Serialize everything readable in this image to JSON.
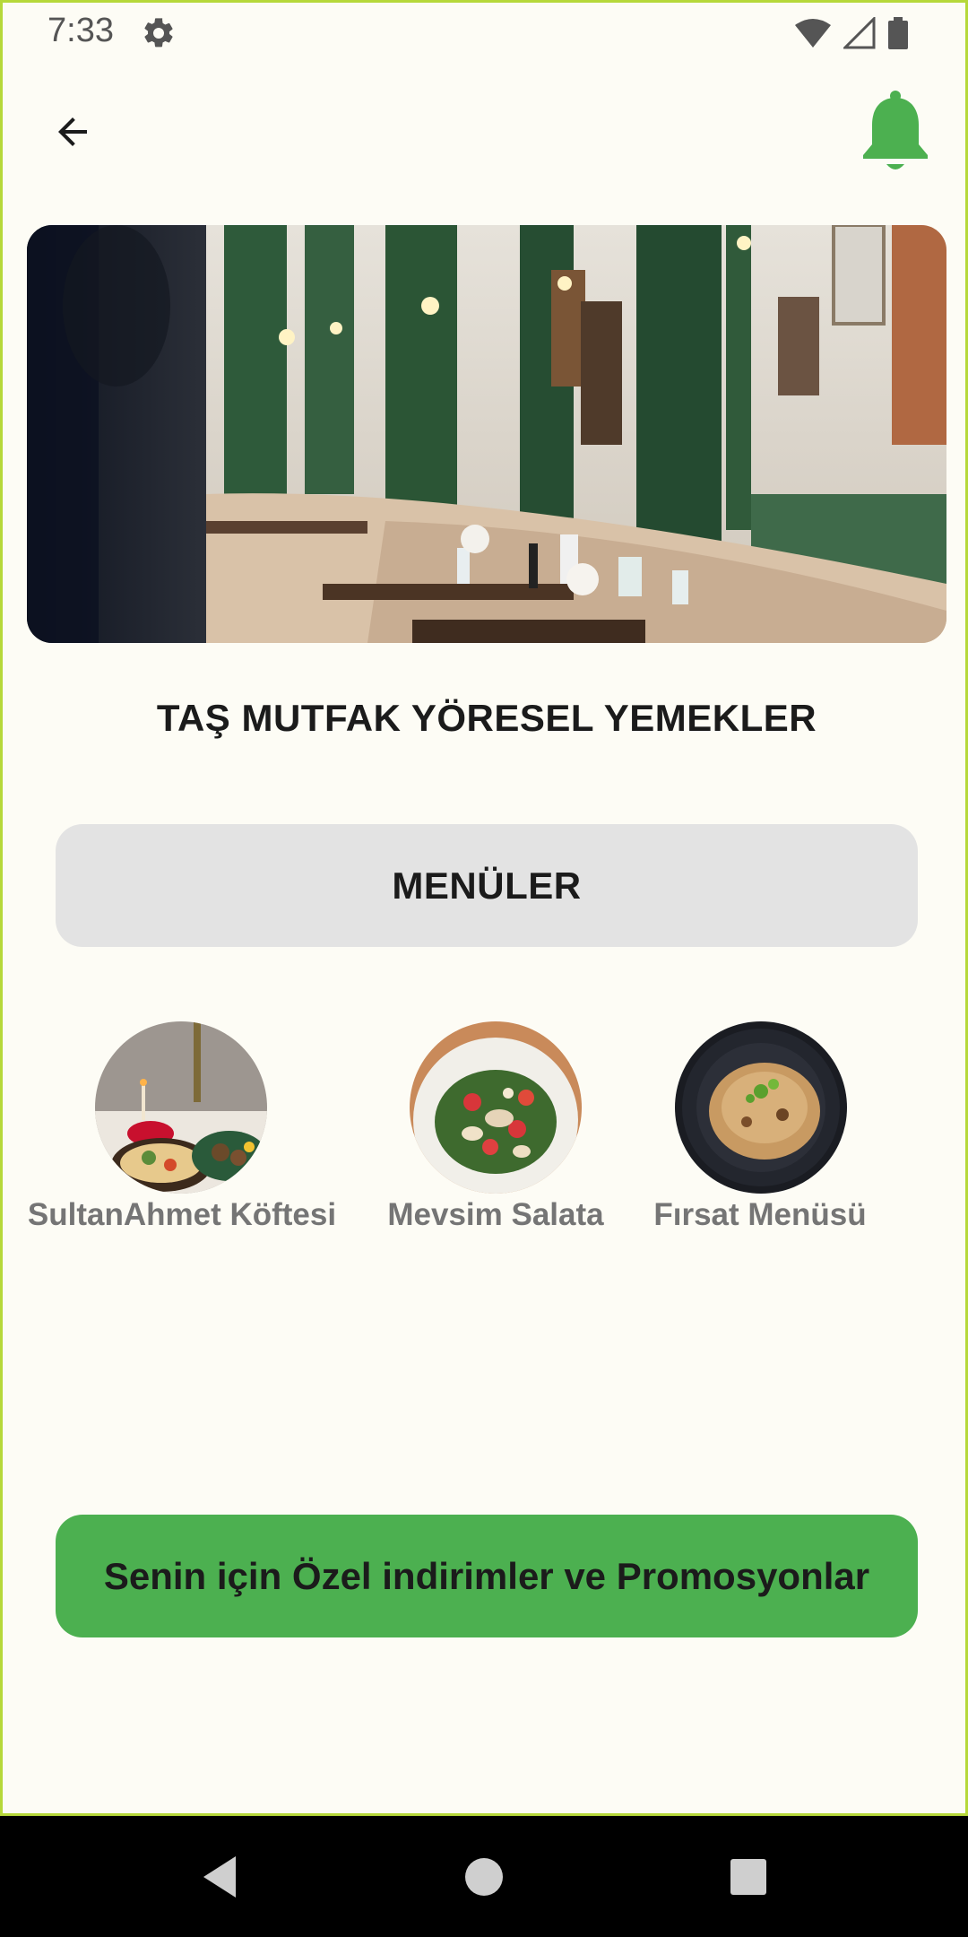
{
  "status_bar": {
    "time": "7:33",
    "icons": [
      "settings-icon",
      "wifi-icon",
      "signal-icon",
      "battery-icon"
    ]
  },
  "app_bar": {
    "back_icon": "arrow-back-icon",
    "notification_icon": "bell-icon"
  },
  "restaurant": {
    "name": "TAŞ MUTFAK YÖRESEL YEMEKLER"
  },
  "buttons": {
    "menus": "MENÜLER",
    "promotions": "Senin için Özel indirimler ve Promosyonlar"
  },
  "menu_items": [
    {
      "label": "SultanAhmet Köftesi"
    },
    {
      "label": "Mevsim Salata"
    },
    {
      "label": "Fırsat Menüsü"
    }
  ],
  "colors": {
    "accent_green": "#4cb050",
    "background": "#fdfcf5",
    "menus_button_bg": "#e3e3e3",
    "label_gray": "#757575"
  },
  "nav_bar": {
    "icons": [
      "back-triangle-icon",
      "home-circle-icon",
      "recents-square-icon"
    ]
  }
}
